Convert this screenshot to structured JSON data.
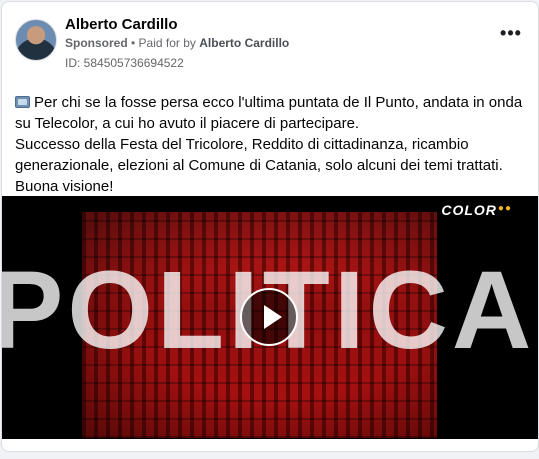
{
  "post": {
    "author": "Alberto Cardillo",
    "sponsored_label": "Sponsored",
    "separator": " • ",
    "paid_for_prefix": "Paid for by ",
    "paid_for_name": "Alberto Cardillo",
    "ad_id": "ID: 584505736694522",
    "text_line1": "Per chi se la fosse persa ecco l'ultima puntata de Il Punto, andata in onda su Telecolor, a cui ho avuto il piacere di partecipare.",
    "text_line2": "Successo della Festa del Tricolore, Reddito di cittadinanza, ricambio generazionale, elezioni al Comune di Catania, solo alcuni dei temi trattati. Buona visione!"
  },
  "video": {
    "overlay_word": "POLITICA",
    "brand_logo": "COLOR",
    "play_icon": "play-icon"
  },
  "icons": {
    "more": "more-options-icon",
    "tv": "television-icon"
  }
}
